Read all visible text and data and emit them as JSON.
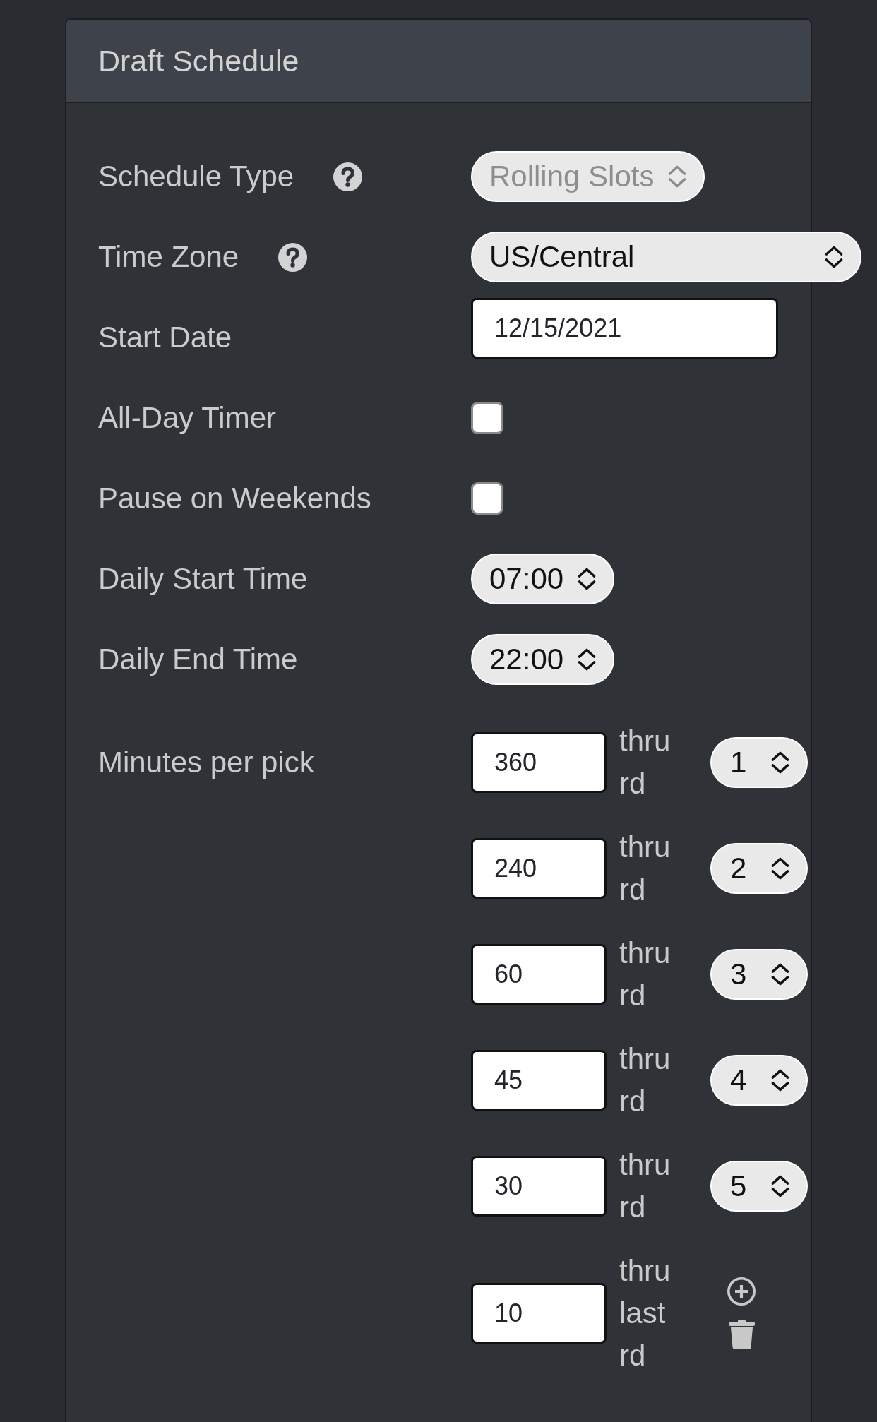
{
  "panel": {
    "title": "Draft Schedule"
  },
  "fields": [
    {
      "kind": "select",
      "label": "Schedule Type",
      "help": true,
      "value": "Rolling Slots",
      "disabled": true
    },
    {
      "kind": "dropdown",
      "label": "Time Zone",
      "help": true,
      "value": "US/Central",
      "disabled": false
    },
    {
      "kind": "date",
      "label": "Start Date",
      "help": false,
      "value": "12/15/2021"
    },
    {
      "kind": "checkbox",
      "label": "All-Day Timer",
      "help": false,
      "checked": false
    },
    {
      "kind": "checkbox",
      "label": "Pause on Weekends",
      "help": false,
      "checked": false
    },
    {
      "kind": "select",
      "label": "Daily Start Time",
      "help": false,
      "value": "07:00",
      "disabled": false
    },
    {
      "kind": "select",
      "label": "Daily End Time",
      "help": false,
      "value": "22:00",
      "disabled": false
    }
  ],
  "minutes_per_pick": {
    "label": "Minutes per pick",
    "tiers": [
      {
        "kind": "round",
        "minutes": "360",
        "thru": "thru rd",
        "round": "1"
      },
      {
        "kind": "round",
        "minutes": "240",
        "thru": "thru rd",
        "round": "2"
      },
      {
        "kind": "round",
        "minutes": "60",
        "thru": "thru rd",
        "round": "3"
      },
      {
        "kind": "round",
        "minutes": "45",
        "thru": "thru rd",
        "round": "4"
      },
      {
        "kind": "round",
        "minutes": "30",
        "thru": "thru rd",
        "round": "5"
      },
      {
        "kind": "last",
        "minutes": "10",
        "thru": "thru last rd"
      }
    ]
  }
}
